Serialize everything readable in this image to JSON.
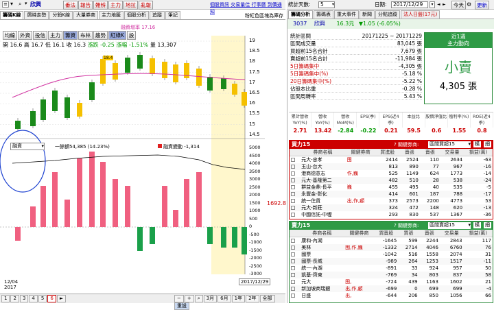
{
  "topbar": {
    "dropdown": "▾",
    "stock": "欣興",
    "menus": [
      "番法",
      "報告",
      "難辨",
      "主力",
      "地拉",
      "亂報"
    ],
    "links": [
      "個股資訊",
      "交易量佳",
      "行事曆",
      "到價通知"
    ]
  },
  "right_top": {
    "date_label": "統計天數:",
    "days": "5",
    "date_text": "日期:",
    "date": "2017/12/29",
    "today": "今天",
    "update": "更新"
  },
  "left_tabs": [
    "籌碼K線",
    "屑峙走勢",
    "分鉛K線",
    "大量券商",
    "主力地籤",
    "個股分析",
    "追蹤",
    "筆記"
  ],
  "note": "粉紅色區塊為庫存",
  "indicator_tabs": [
    "均線",
    "外資",
    "投信",
    "主力",
    "籌資",
    "布林",
    "趨勢",
    "紅綠K",
    "設"
  ],
  "ohlc": {
    "o": "開 16.6",
    "h": "高 16.7",
    "l": "低 16.1",
    "c": "收 16.3",
    "chg": "漲跌 -0.25",
    "pct": "漲幅 -1.51%",
    "vol": "量 13,307"
  },
  "legend1": "融資增率 17.16",
  "price_axis": [
    "19",
    "18.5",
    "18",
    "17.5",
    "17",
    "16.5",
    "16",
    "15.5",
    "15",
    "14.5"
  ],
  "price_tag": "18.4",
  "sub_select": "融資",
  "sub_legend": {
    "a": "一餘額54,385 (14.23%)",
    "b": "融資變動 -1,314"
  },
  "vol_axis": [
    "5000",
    "4500",
    "4000",
    "3500",
    "3000",
    "2500",
    "2000",
    "1500",
    "1000",
    "500",
    "0",
    "-500",
    "-1000",
    "-1500",
    "-2000",
    "-2500",
    "-3000"
  ],
  "vol_tag": "1692.8",
  "date_start": "12/04",
  "date_year": "2017",
  "date_end": "2017/12/29",
  "pages": [
    "1",
    "2",
    "3",
    "4",
    "5",
    "6"
  ],
  "zoom": [
    "3月",
    "6月",
    "1年",
    "2年",
    "全部",
    "重設"
  ],
  "right_tabs": [
    "籌碼分析",
    "籌碼表",
    "重大事件",
    "新聞",
    "分點追蹤",
    "法人日盤(17元)"
  ],
  "stock_line": {
    "code": "3037",
    "name": "欣興",
    "price": "16.3元",
    "chg": "▼1.05 (-6.05%)"
  },
  "stats": [
    {
      "label": "統計區間",
      "val": "20171225 ~ 20171229"
    },
    {
      "label": "區間成交量",
      "val": "83,045 張"
    },
    {
      "label": "買超前15名合計",
      "val": "7,679 張"
    },
    {
      "label": "賣超前15名合計",
      "val": "-11,984 張"
    },
    {
      "label": "5日籌碼集中",
      "val": "-4,305 張"
    },
    {
      "label": "5日籌碼集中(%)",
      "val": "-5.18 %"
    },
    {
      "label": "20日籌碼集中(%)",
      "val": "-5.22 %"
    },
    {
      "label": "佔股本比重",
      "val": "-0.28 %"
    },
    {
      "label": "區間周轉率",
      "val": "5.43 %"
    }
  ],
  "green_box": {
    "t1": "近1週",
    "t2": "主力動向",
    "big": "小賣",
    "num": "4,305 張"
  },
  "fund_hdr": [
    "累計營收YoY(%)",
    "營收YoY(%)",
    "營收MoM(%)",
    "EPS(季)",
    "EPS(近4季)",
    "本益比",
    "股價淨值比",
    "殖利率(%)",
    "ROE(近4季)"
  ],
  "fund_val": [
    "2.71",
    "13.42",
    "-2.84",
    "-0.22",
    "0.21",
    "59.5",
    "0.6",
    "1.55",
    "0.8"
  ],
  "buy": {
    "title": "買力15",
    "hint": "? 關鍵券商:",
    "sel": "區間買超15",
    "b1": "橫",
    "b2": "細",
    "cols": [
      "券商名稱",
      "關鍵券商",
      "買進股",
      "賣張",
      "賣張",
      "交易量",
      "損益(萬)"
    ],
    "rows": [
      [
        "元大-忠孝",
        "囤",
        "2414",
        "2524",
        "110",
        "2634",
        "-63"
      ],
      [
        "玉山-台大",
        "",
        "813",
        "890",
        "77",
        "967",
        "-16"
      ],
      [
        "港商德意志",
        "作,巍",
        "525",
        "1149",
        "624",
        "1773",
        "-14"
      ],
      [
        "元大-基隆第二",
        "",
        "482",
        "510",
        "28",
        "538",
        "-24"
      ],
      [
        "群益金鼎-長平",
        "巍",
        "455",
        "495",
        "40",
        "535",
        "-5"
      ],
      [
        "永豐金-彰化",
        "",
        "414",
        "601",
        "187",
        "788",
        "-17"
      ],
      [
        "統一住貨",
        "出,作,顧",
        "373",
        "2573",
        "2200",
        "4773",
        "53"
      ],
      [
        "元大-新莊",
        "",
        "324",
        "472",
        "148",
        "620",
        "-13"
      ],
      [
        "中國信託-中壢",
        "",
        "293",
        "830",
        "537",
        "1367",
        "-36"
      ]
    ]
  },
  "sell": {
    "title": "賣力15",
    "hint": "? 關鍵券商:",
    "sel": "區間賣超15",
    "b1": "橫",
    "b2": "細",
    "cols": [
      "券商名稱",
      "關鍵券商",
      "買賣股",
      "買張",
      "賣張",
      "交易量",
      "損益(萬)"
    ],
    "rows": [
      [
        "康和-內湖",
        "",
        "-1645",
        "599",
        "2244",
        "2843",
        "117"
      ],
      [
        "美林",
        "囤,作,巍",
        "-1332",
        "2714",
        "4046",
        "6760",
        "76"
      ],
      [
        "國票",
        "",
        "-1042",
        "516",
        "1558",
        "2074",
        "31"
      ],
      [
        "國票-長城",
        "",
        "-989",
        "264",
        "1253",
        "1517",
        "-11"
      ],
      [
        "統一-內湖",
        "",
        "-891",
        "33",
        "924",
        "957",
        "50"
      ],
      [
        "凱基-齊東",
        "",
        "-769",
        "34",
        "803",
        "837",
        "58"
      ],
      [
        "元大",
        "囤,",
        "-724",
        "439",
        "1163",
        "1602",
        "21"
      ],
      [
        "新加坡商瑞銀",
        "出,作,顧",
        "-699",
        "0",
        "699",
        "699",
        "-4"
      ],
      [
        "日盛",
        "出,",
        "-644",
        "206",
        "850",
        "1056",
        "66"
      ]
    ]
  }
}
